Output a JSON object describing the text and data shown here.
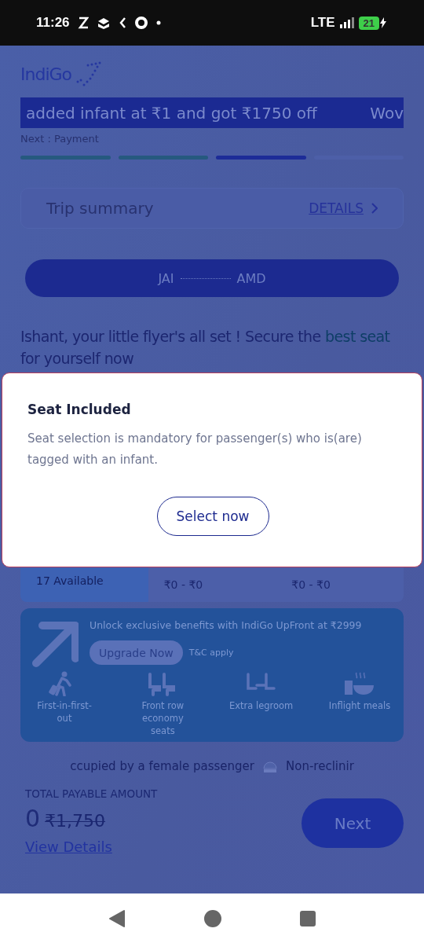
{
  "status_bar": {
    "time": "11:26",
    "network": "LTE",
    "battery": "21"
  },
  "header": {
    "logo": "IndiGo"
  },
  "banner": {
    "text": "added infant at ₹1 and got ₹1750 off",
    "next_text": "Wov"
  },
  "next_step": "Next : Payment",
  "progress": [
    {
      "completed": true,
      "current": false
    },
    {
      "completed": true,
      "current": false
    },
    {
      "completed": false,
      "current": true
    },
    {
      "completed": false,
      "current": false
    }
  ],
  "trip_summary": {
    "title": "Trip summary",
    "link": "DETAILS"
  },
  "route": {
    "from": "JAI",
    "to": "AMD"
  },
  "heading": {
    "before": "Ishant, your little flyer's all set ! Secure the ",
    "highlight": "best seat",
    "after": " for yourself now"
  },
  "fares": [
    {
      "selected": true,
      "text": "17 Available"
    },
    {
      "selected": false,
      "text": "₹0 - ₹0"
    },
    {
      "selected": false,
      "text": "₹0 - ₹0"
    }
  ],
  "upfront": {
    "text": "Unlock exclusive benefits with IndiGo UpFront at ₹2999",
    "button": "Upgrade Now",
    "terms": "T&C apply",
    "features": [
      {
        "kind": "walker",
        "label": "First-in-first-out"
      },
      {
        "kind": "seats",
        "label": "Front row economy seats"
      },
      {
        "kind": "legroom",
        "label": "Extra legroom"
      },
      {
        "kind": "meal",
        "label": "Inflight meals"
      }
    ]
  },
  "legend": [
    {
      "kind": "text",
      "label": "ccupied by a female passenger"
    },
    {
      "kind": "seat",
      "label": "Non-reclinir"
    }
  ],
  "total": {
    "label": "TOTAL PAYABLE AMOUNT",
    "amount": "0",
    "old_amount": "₹1,750",
    "link": "View Details",
    "button": "Next"
  },
  "modal": {
    "title": "Seat Included",
    "body": "Seat selection is mandatory for passenger(s) who is(are) tagged with an infant.",
    "button": "Select now"
  }
}
